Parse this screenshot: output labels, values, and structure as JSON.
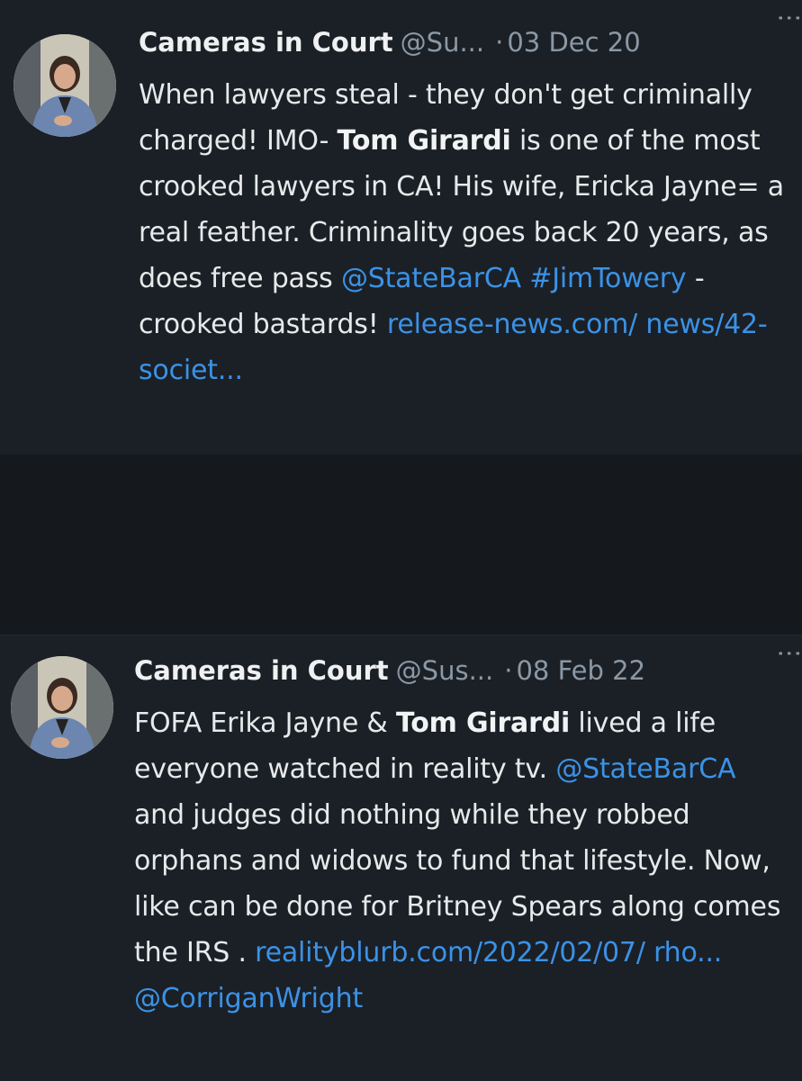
{
  "tweets": [
    {
      "name": "Cameras in Court",
      "handle": "@Su...",
      "dot": "·",
      "date": "03 Dec 20",
      "avatar_icon": "profile-photo",
      "segments": [
        "When lawyers steal - they don't get criminally charged! IMO- ",
        "Tom Girardi",
        "  is one of the most crooked lawyers in CA! His wife,  Ericka Jayne= a real feather. Criminality goes back 20 years, as does free pass  ",
        "@StateBarCA",
        " ",
        "#JimTowery",
        " - crooked bastards! ",
        "release-news.com/ news/42-societ..."
      ]
    },
    {
      "name": "Cameras in Court",
      "handle": "@Sus...",
      "dot": "·",
      "date": "08 Feb 22",
      "avatar_icon": "profile-photo",
      "segments": [
        "FOFA Erika Jayne & ",
        "Tom Girardi",
        " lived a life everyone watched in reality tv. ",
        "@StateBarCA",
        " and judges did nothing while they robbed orphans and widows to fund that lifestyle. Now, like can be done for Britney Spears  along comes the IRS .  ",
        "realityblurb.com/2022/02/07/ rho...",
        " ",
        "@CorriganWright"
      ]
    }
  ],
  "colors": {
    "background": "#15191d",
    "card": "#1b2026",
    "link": "#3b92e6",
    "muted": "#8b98a5"
  }
}
